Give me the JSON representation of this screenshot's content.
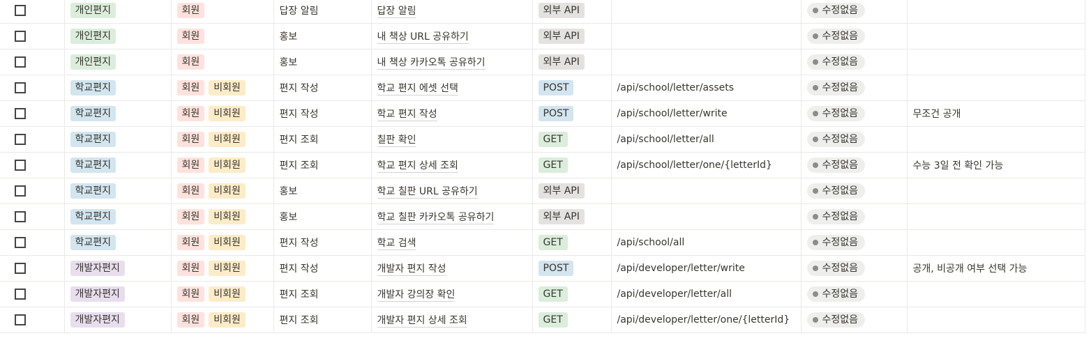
{
  "colors": {
    "개인편지": "#dbeddb",
    "학교편지": "#d3e5ef",
    "개발자편지": "#e8deee",
    "회원": "#ffe2dd",
    "비회원": "#fdecc8",
    "외부 API": "#e3e2e0",
    "POST": "#d3e5ef",
    "GET": "#dbeddb"
  },
  "rows": [
    {
      "category": "개인편지",
      "users": [
        "회원"
      ],
      "type": "답장 알림",
      "name": "답장 알림",
      "method": "외부 API",
      "path": "",
      "status": "수정없음",
      "note": ""
    },
    {
      "category": "개인편지",
      "users": [
        "회원"
      ],
      "type": "홍보",
      "name": "내 책상 URL 공유하기",
      "method": "외부 API",
      "path": "",
      "status": "수정없음",
      "note": ""
    },
    {
      "category": "개인편지",
      "users": [
        "회원"
      ],
      "type": "홍보",
      "name": "내 책상 카카오톡 공유하기",
      "method": "외부 API",
      "path": "",
      "status": "수정없음",
      "note": ""
    },
    {
      "category": "학교편지",
      "users": [
        "회원",
        "비회원"
      ],
      "type": "편지 작성",
      "name": "학교 편지 에셋 선택",
      "method": "POST",
      "path": "/api/school/letter/assets",
      "status": "수정없음",
      "note": ""
    },
    {
      "category": "학교편지",
      "users": [
        "회원",
        "비회원"
      ],
      "type": "편지 작성",
      "name": "학교 편지 작성",
      "method": "POST",
      "path": "/api/school/letter/write",
      "status": "수정없음",
      "note": "무조건 공개"
    },
    {
      "category": "학교편지",
      "users": [
        "회원",
        "비회원"
      ],
      "type": "편지 조회",
      "name": "칠판 확인",
      "method": "GET",
      "path": "/api/school/letter/all",
      "status": "수정없음",
      "note": ""
    },
    {
      "category": "학교편지",
      "users": [
        "회원",
        "비회원"
      ],
      "type": "편지 조회",
      "name": "학교 편지 상세 조회",
      "method": "GET",
      "path": "/api/school/letter/one/{letterId}",
      "status": "수정없음",
      "note": "수능 3일 전 확인 가능"
    },
    {
      "category": "학교편지",
      "users": [
        "회원",
        "비회원"
      ],
      "type": "홍보",
      "name": "학교 칠판 URL 공유하기",
      "method": "외부 API",
      "path": "",
      "status": "수정없음",
      "note": ""
    },
    {
      "category": "학교편지",
      "users": [
        "회원",
        "비회원"
      ],
      "type": "홍보",
      "name": "학교 칠판 카카오톡 공유하기",
      "method": "외부 API",
      "path": "",
      "status": "수정없음",
      "note": ""
    },
    {
      "category": "학교편지",
      "users": [
        "회원",
        "비회원"
      ],
      "type": "편지 작성",
      "name": "학교 검색",
      "method": "GET",
      "path": "/api/school/all",
      "status": "수정없음",
      "note": ""
    },
    {
      "category": "개발자편지",
      "users": [
        "회원",
        "비회원"
      ],
      "type": "편지 작성",
      "name": "개발자 편지 작성",
      "method": "POST",
      "path": "/api/developer/letter/write",
      "status": "수정없음",
      "note": "공개, 비공개 여부 선택 가능"
    },
    {
      "category": "개발자편지",
      "users": [
        "회원",
        "비회원"
      ],
      "type": "편지 조회",
      "name": "개발자 강의장 확인",
      "method": "GET",
      "path": "/api/developer/letter/all",
      "status": "수정없음",
      "note": ""
    },
    {
      "category": "개발자편지",
      "users": [
        "회원",
        "비회원"
      ],
      "type": "편지 조회",
      "name": "개발자 편지 상세 조회",
      "method": "GET",
      "path": "/api/developer/letter/one/{letterId}",
      "status": "수정없음",
      "note": ""
    }
  ]
}
